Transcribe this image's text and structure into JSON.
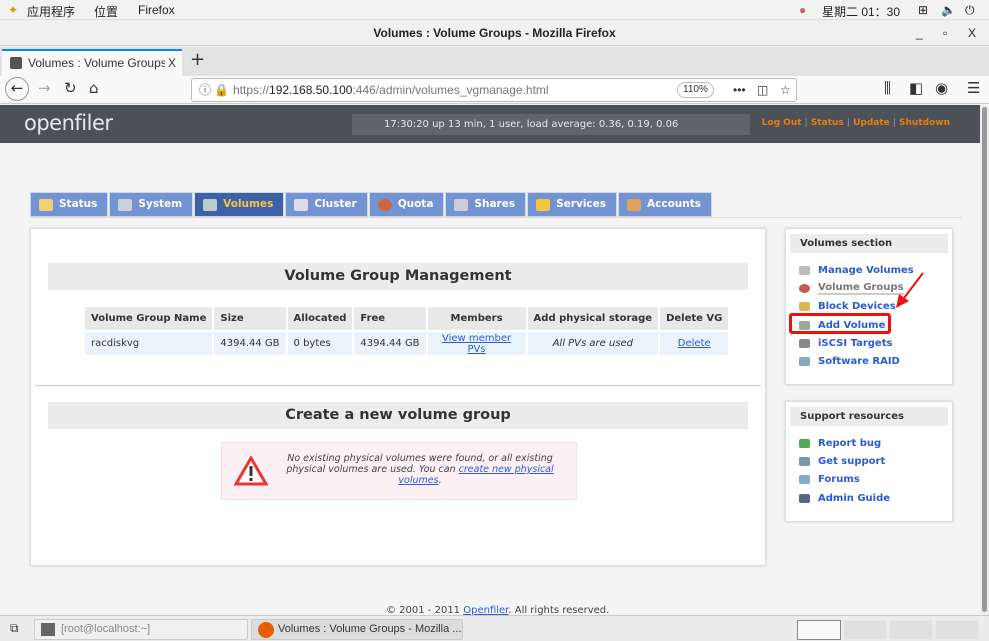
{
  "gnome": {
    "apps": "应用程序",
    "places": "位置",
    "firefox": "Firefox",
    "clock": "星期二 01：30"
  },
  "window": {
    "title": "Volumes : Volume Groups - Mozilla Firefox",
    "min": "_",
    "max": "▫",
    "close": "X"
  },
  "browser": {
    "tab_title": "Volumes : Volume Groups",
    "tab_close": "X",
    "new_tab": "+",
    "url_proto": "https://",
    "url_host": "192.168.50.100",
    "url_rest": ":446/admin/volumes_vgmanage.html",
    "zoom": "110%"
  },
  "header": {
    "logo": "openfiler",
    "uptime": "17:30:20 up 13 min, 1 user, load average: 0.36, 0.19, 0.06",
    "links": [
      "Log Out",
      "Status",
      "Update",
      "Shutdown"
    ]
  },
  "tabs": [
    {
      "label": "Status"
    },
    {
      "label": "System"
    },
    {
      "label": "Volumes",
      "active": true
    },
    {
      "label": "Cluster"
    },
    {
      "label": "Quota"
    },
    {
      "label": "Shares"
    },
    {
      "label": "Services"
    },
    {
      "label": "Accounts"
    }
  ],
  "vgm": {
    "title": "Volume Group Management",
    "columns": [
      "Volume Group Name",
      "Size",
      "Allocated",
      "Free",
      "Members",
      "Add physical storage",
      "Delete VG"
    ],
    "rows": [
      {
        "name": "racdiskvg",
        "size": "4394.44 GB",
        "allocated": "0 bytes",
        "free": "4394.44 GB",
        "members": "View member PVs",
        "add": "All PVs are used",
        "delete": "Delete"
      }
    ]
  },
  "create": {
    "title": "Create a new volume group",
    "msg": "No existing physical volumes were found, or all existing physical volumes are used. You can ",
    "link": "create new physical volumes",
    "end": "."
  },
  "volumes_section": {
    "title": "Volumes section",
    "items": [
      "Manage Volumes",
      "Volume Groups",
      "Block Devices",
      "Add Volume",
      "iSCSI Targets",
      "Software RAID"
    ]
  },
  "support": {
    "title": "Support resources",
    "items": [
      "Report bug",
      "Get support",
      "Forums",
      "Admin Guide"
    ]
  },
  "footer": {
    "pre": "© 2001 - 2011 ",
    "link": "Openfiler",
    "post": ". All rights reserved."
  },
  "taskbar": {
    "terminal": "[root@localhost:~]",
    "firefox": "Volumes : Volume Groups - Mozilla ..."
  },
  "colors": {
    "accent": "#3e62a8",
    "tab": "#7394d2",
    "link": "#2a5bd7",
    "highlight": "#f01010",
    "orange": "#e67e0e"
  }
}
